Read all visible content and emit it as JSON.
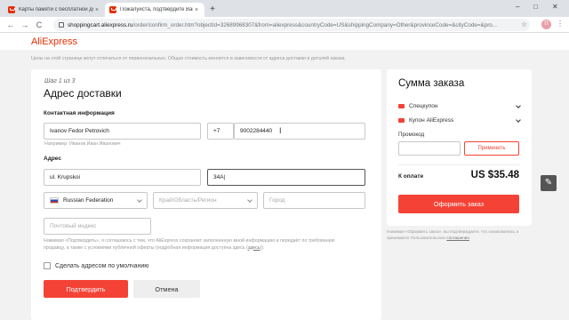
{
  "browser": {
    "tabs": [
      {
        "title": "Карты памяти с бесплатной доставкой",
        "active": false
      },
      {
        "title": "Пожалуйста, подтвердите Ваш заказ",
        "active": true
      }
    ],
    "new_tab_icon": "+",
    "url_host": "shoppingcart.aliexpress.ru",
    "url_path": "/order/confirm_order.htm?objectId=32689968307&from=aliexpress&countryCode=US&shippingCompany=Other&provinceCode=&cityCode=&pro...",
    "profile_initial": "П",
    "nav_back": "←",
    "nav_forward": "→",
    "nav_reload": "C",
    "star_icon": "☆",
    "menu_icon": "⋮",
    "window_controls": [
      "–",
      "□",
      "✕"
    ]
  },
  "header": {
    "logo": "AliExpress"
  },
  "notice": "Цены на этой странице могут отличаться от первоначальных. Общая стоимость меняется в зависимости от адреса доставки и деталей заказа.",
  "address_form": {
    "step": "Шаг 1 из 3",
    "title": "Адрес доставки",
    "contact_section": "Контактная информация",
    "name_value": "Ivanov Fedor Petrovich",
    "phone_code": "+7",
    "phone_value": "9002284440",
    "name_hint": "Например: Иванов Иван Иванович",
    "address_section": "Адрес",
    "street_value": "ul. Krupskoi",
    "house_value": "34A",
    "country_value": "Russian Federation",
    "region_placeholder": "Край/Область/Регион",
    "city_placeholder": "Город",
    "postal_placeholder": "Почтовый индекс",
    "legal_text": "Нажимая «Подтвердить», я соглашаюсь с тем, что AliExpress сохраняет заполненную мной информацию и передаёт по требованию продавцу, а также с условиями публичной оферты (подробная информация доступна здесь (",
    "legal_link": "здесь",
    "legal_end": ")).",
    "default_checkbox_label": "Сделать адресом по умолчанию",
    "confirm_button": "Подтвердить",
    "cancel_button": "Отмена"
  },
  "summary": {
    "title": "Сумма заказа",
    "coupon_1": "Спецкупон",
    "coupon_2": "Купон AliExpress",
    "promo_label": "Промокод",
    "promo_button": "Применить",
    "total_label": "К оплате",
    "total_value": "US $35.48",
    "checkout_button": "Оформить заказ",
    "note_text": "Нажимая «Оформить заказ», вы подтверждаете, что ознакомились и принимаете Пользовательское",
    "note_link": "соглашение",
    "note_end": "."
  },
  "colors": {
    "accent": "#f44336",
    "brand": "#e62e04"
  },
  "icons": {
    "edit_fab": "✎"
  }
}
